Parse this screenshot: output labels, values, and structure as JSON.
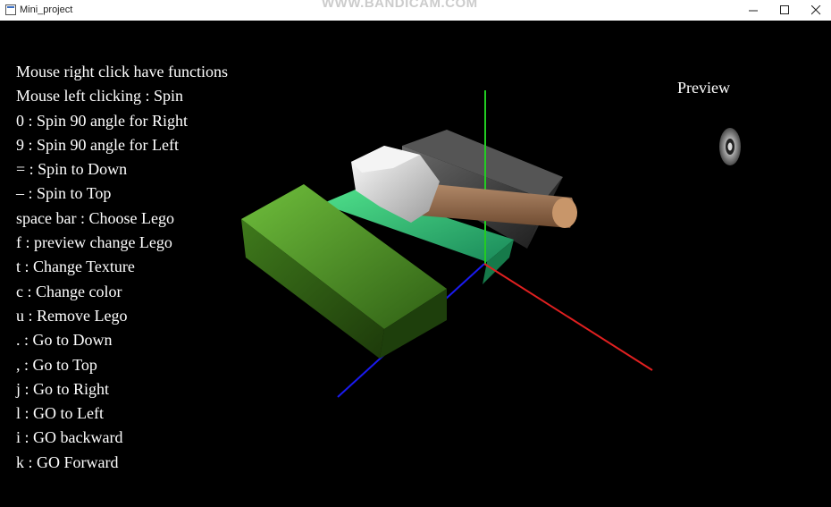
{
  "window": {
    "title": "Mini_project",
    "watermark": "WWW.BANDICAM.COM"
  },
  "help_lines": [
    "Mouse right click have functions",
    "Mouse left clicking : Spin",
    "0 : Spin 90 angle for Right",
    "9 : Spin 90 angle for Left",
    "= : Spin to Down",
    "– : Spin to Top",
    "space bar : Choose Lego",
    "f : preview change Lego",
    "t : Change Texture",
    "c : Change color",
    "u : Remove Lego",
    ". : Go to Down",
    ", : Go to Top",
    "j : Go to Right",
    "l : GO to Left",
    "i : GO backward",
    "k : GO Forward"
  ],
  "preview": {
    "label": "Preview"
  },
  "colors": {
    "axis_x": "#e02020",
    "axis_y": "#22cc22",
    "axis_z": "#1a1aee",
    "background": "#000000"
  }
}
